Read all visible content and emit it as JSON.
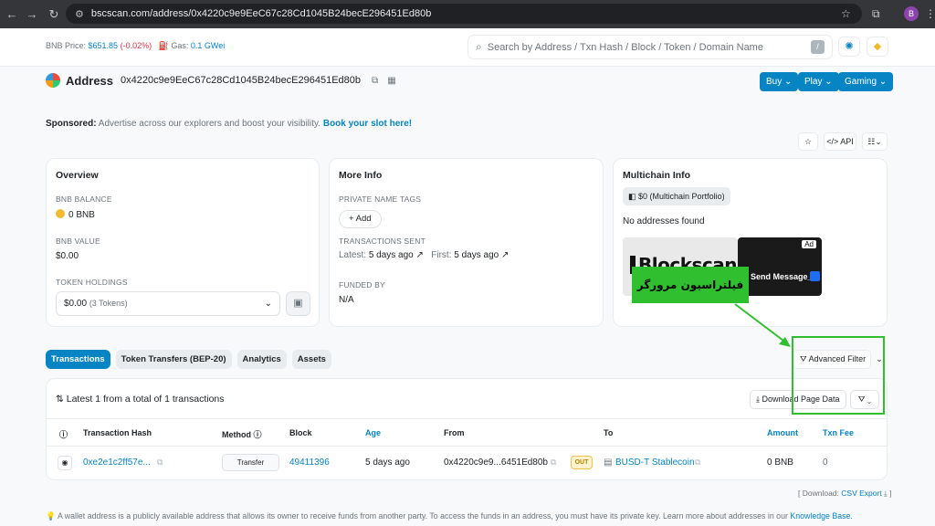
{
  "browser": {
    "url": "bscscan.com/address/0x4220c9e9EeC67c28Cd1045B24becE296451Ed80b",
    "profile_initial": "B"
  },
  "header": {
    "bnb_price_label": "BNB Price:",
    "bnb_price_value": "$651.85",
    "bnb_price_change": "(-0.02%)",
    "gas_label": "Gas:",
    "gas_value": "0.1 GWei",
    "search_placeholder": "Search by Address / Txn Hash / Block / Token / Domain Name",
    "slash_key": "/"
  },
  "address": {
    "title": "Address",
    "hash": "0x4220c9e9EeC67c28Cd1045B24becE296451Ed80b"
  },
  "top_buttons": {
    "buy": "Buy",
    "play": "Play",
    "gaming": "Gaming"
  },
  "sponsored": {
    "label": "Sponsored:",
    "text": "Advertise across our explorers and boost your visibility.",
    "link": "Book your slot here!"
  },
  "toolbar": {
    "api": "API"
  },
  "overview": {
    "title": "Overview",
    "balance_label": "BNB BALANCE",
    "balance_value": "0 BNB",
    "value_label": "BNB VALUE",
    "value_value": "$0.00",
    "holdings_label": "TOKEN HOLDINGS",
    "holdings_value": "$0.00",
    "holdings_count": "(3 Tokens)"
  },
  "more_info": {
    "title": "More Info",
    "name_tags_label": "PRIVATE NAME TAGS",
    "add_button": "+ Add",
    "tx_sent_label": "TRANSACTIONS SENT",
    "latest_label": "Latest:",
    "latest_value": "5 days ago",
    "first_label": "First:",
    "first_value": "5 days ago",
    "funded_label": "FUNDED BY",
    "funded_value": "N/A"
  },
  "multichain": {
    "title": "Multichain Info",
    "portfolio": "$0 (Multichain Portfolio)",
    "no_addresses": "No addresses found",
    "ad_brand": "Blockscan",
    "ad_message": "Send Message_",
    "ad_tag": "Ad"
  },
  "annotation": {
    "label": "فیلتراسیون مرورگر"
  },
  "tabs": [
    "Transactions",
    "Token Transfers (BEP-20)",
    "Analytics",
    "Assets"
  ],
  "advanced_filter": "Advanced Filter",
  "transactions": {
    "summary": "Latest 1 from a total of 1 transactions",
    "download": "Download Page Data",
    "columns": [
      "Transaction Hash",
      "Method",
      "Block",
      "Age",
      "From",
      "To",
      "Amount",
      "Txn Fee"
    ],
    "rows": [
      {
        "hash": "0xe2e1c2ff57e...",
        "method": "Transfer",
        "block": "49411396",
        "age": "5 days ago",
        "from": "0x4220c9e9...6451Ed80b",
        "direction": "OUT",
        "to": "BUSD-T Stablecoin",
        "amount": "0 BNB",
        "fee": "0"
      }
    ]
  },
  "csv": {
    "prefix": "[ Download:",
    "link": "CSV Export"
  },
  "footer": {
    "text": "A wallet address is a publicly available address that allows its owner to receive funds from another party. To access the funds in an address, you must have its private key. Learn more about addresses in our",
    "link": "Knowledge Base."
  },
  "colors": {
    "accent": "#0784c3",
    "annotation_green": "#2fbf2f",
    "chrome_dark": "#35363a"
  }
}
